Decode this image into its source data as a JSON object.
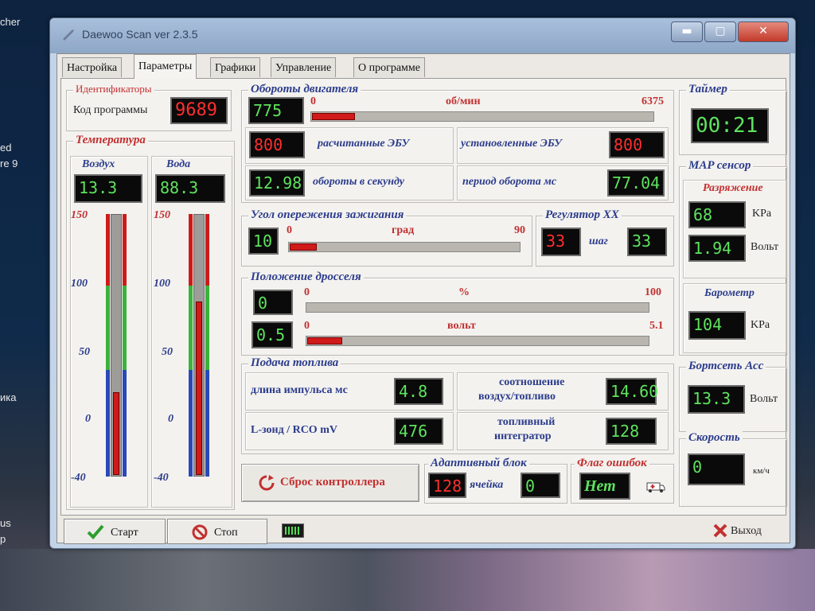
{
  "desktop": {
    "left_labels": [
      "cher",
      "ed",
      "re 9",
      "ика",
      "us",
      "p"
    ]
  },
  "window": {
    "title": "Daewoo Scan ver 2.3.5",
    "min_label": "▬",
    "max_label": "▢",
    "close_label": "✕"
  },
  "tabs": [
    {
      "label": "Настройка"
    },
    {
      "label": "Параметры"
    },
    {
      "label": "Графики"
    },
    {
      "label": "Управление"
    },
    {
      "label": "О программе"
    }
  ],
  "ident": {
    "title": "Идентификаторы",
    "code_label": "Код программы",
    "code_value": "9689"
  },
  "temperature": {
    "title": "Температура",
    "air": {
      "label": "Воздух",
      "value": "13.3",
      "level": 0.32
    },
    "water": {
      "label": "Вода",
      "value": "88.3",
      "level": 0.67
    },
    "ticks": [
      "150",
      "100",
      "50",
      "0",
      "-40"
    ]
  },
  "rpm": {
    "title": "Обороты двигателя",
    "value": "775",
    "min": "0",
    "unit": "об/мин",
    "max": "6375",
    "fraction": 0.122,
    "ecu_calc_value": "800",
    "ecu_calc_label": "расчитанные ЭБУ",
    "ecu_set_label": "установленные ЭБУ",
    "ecu_set_value": "800",
    "rps_value": "12.98",
    "rps_label": "обороты в секунду",
    "period_label": "период оборота  мс",
    "period_value": "77.04"
  },
  "ignition": {
    "title": "Угол опережения зажигания",
    "value": "10",
    "min": "0",
    "unit": "град",
    "max": "90",
    "fraction": 0.111
  },
  "idle": {
    "title": "Регулятор ХХ",
    "value_red": "33",
    "unit": "шаг",
    "value_green": "33"
  },
  "throttle": {
    "title": "Положение дросселя",
    "pct_value": "0",
    "pct_min": "0",
    "pct_unit": "%",
    "pct_max": "100",
    "pct_fraction": 0.0,
    "volt_value": "0.5",
    "volt_min": "0",
    "volt_unit": "вольт",
    "volt_max": "5.1",
    "volt_fraction": 0.098
  },
  "fuel": {
    "title": "Подача топлива",
    "pulse_label": "длина импульса  мс",
    "pulse_value": "4.8",
    "lambda_label": "L-зонд / RCO  mV",
    "lambda_value": "476",
    "ratio_label_1": "соотношение",
    "ratio_label_2": "воздух/топливо",
    "ratio_value": "14.60",
    "integrator_label_1": "топливный",
    "integrator_label_2": "интегратор",
    "integrator_value": "128"
  },
  "reset": {
    "label": "Сброс контроллера"
  },
  "adaptive": {
    "title": "Адаптивный блок",
    "value": "128",
    "cell_label": "ячейка",
    "cell_value": "0"
  },
  "errors": {
    "title": "Флаг ошибок",
    "value": "Нет"
  },
  "timer": {
    "title": "Таймер",
    "value": "00:21"
  },
  "map": {
    "title": "MAP сенсор",
    "vacuum_title": "Разряжение",
    "kpa_value": "68",
    "kpa_unit": "KPa",
    "volt_value": "1.94",
    "volt_unit": "Вольт",
    "baro_title": "Барометр",
    "baro_value": "104",
    "baro_unit": "KPa"
  },
  "battery": {
    "title": "Бортсеть Асс",
    "value": "13.3",
    "unit": "Вольт"
  },
  "speed": {
    "title": "Скорость",
    "value": "0",
    "unit": "км/ч"
  },
  "bottom": {
    "start_label": "Старт",
    "stop_label": "Стоп",
    "exit_label": "Выход"
  }
}
